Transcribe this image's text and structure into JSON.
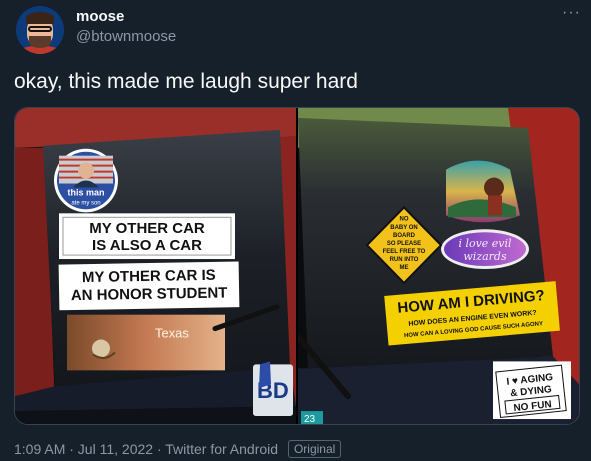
{
  "author": {
    "name": "moose",
    "handle": "@btownmoose"
  },
  "tweet": {
    "text": "okay, this made me laugh super hard"
  },
  "more_icon": "more-horizontal-icon",
  "left_photo": {
    "sticker_round": [
      "this man",
      "ate my son"
    ],
    "sticker_1": [
      "MY OTHER CAR",
      "IS ALSO A CAR"
    ],
    "sticker_2": [
      "MY OTHER CAR IS",
      "AN HONOR STUDENT"
    ],
    "sticker_3": "Texas",
    "plate_fragment": "BD"
  },
  "right_photo": {
    "diamond": [
      "NO",
      "BABY ON",
      "BOARD",
      "SO PLEASE",
      "FEEL FREE TO",
      "RUN INTO",
      "ME"
    ],
    "oval": [
      "i love evil",
      "wizards"
    ],
    "driving": [
      "HOW AM I DRIVING?",
      "HOW DOES AN ENGINE EVEN WORK?",
      "HOW CAN A LOVING GOD CAUSE SUCH AGONY"
    ],
    "aging": [
      "I ♥ AGING",
      "& DYING",
      "NO FUN"
    ],
    "plate_fragment": "23"
  },
  "meta": {
    "timestamp": "1:09 AM · Jul 11, 2022 · Twitter for Android",
    "badge": "Original"
  }
}
